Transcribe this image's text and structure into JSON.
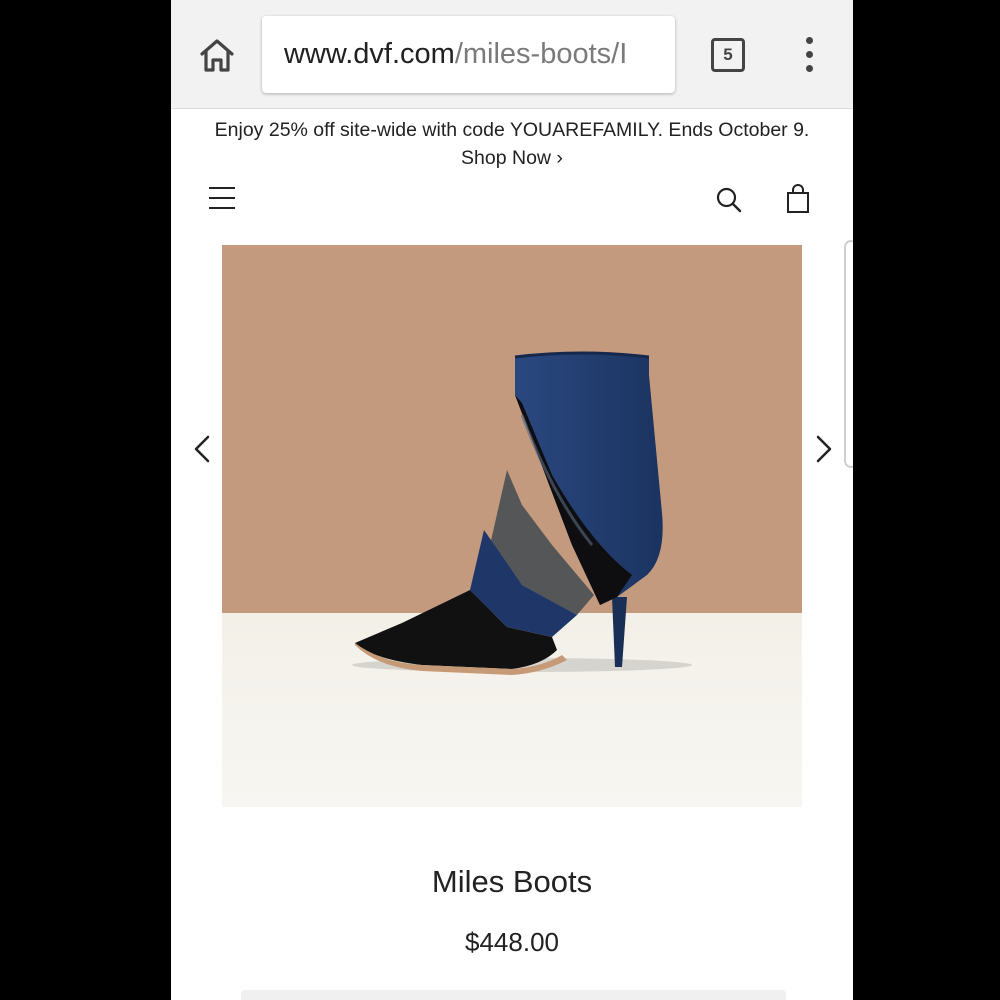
{
  "browser": {
    "url_host": "www.dvf.com",
    "url_path": "/miles-boots/I",
    "tab_count": "5",
    "icons": {
      "home": "home-icon",
      "menu": "more-vert-icon"
    }
  },
  "promo": {
    "text": "Enjoy 25% off site-wide with code YOUAREFAMILY. Ends October 9.",
    "link_label": "Shop Now ›"
  },
  "header": {
    "icons": {
      "menu": "hamburger-icon",
      "search": "search-icon",
      "bag": "shopping-bag-icon"
    }
  },
  "product": {
    "name": "Miles Boots",
    "price": "$448.00",
    "image_colors": {
      "backdrop": "#c49a7f",
      "floor": "#f2efe7",
      "navy": "#1f3a6a",
      "black": "#141414",
      "grey": "#555555"
    }
  },
  "carousel": {
    "icons": {
      "prev": "chevron-left-icon",
      "next": "chevron-right-icon"
    }
  }
}
